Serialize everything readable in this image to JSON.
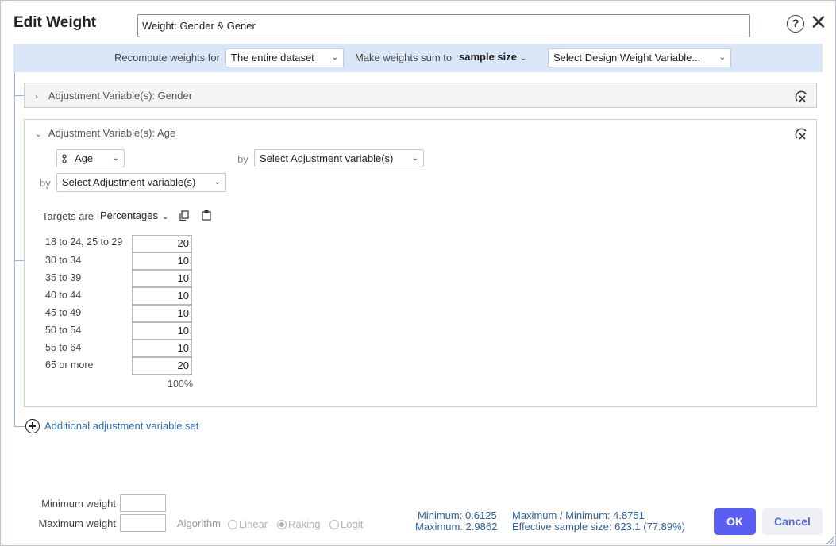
{
  "dialog": {
    "title": "Edit Weight",
    "name_value": "Weight: Gender & Gener"
  },
  "toolbar": {
    "recompute_label": "Recompute weights for",
    "recompute_value": "The entire dataset",
    "sum_label": "Make weights sum to",
    "sum_value": "sample size",
    "design_weight_placeholder": "Select Design Weight Variable..."
  },
  "panels": [
    {
      "title": "Adjustment Variable(s): Gender",
      "expanded": false
    },
    {
      "title": "Adjustment Variable(s): Age",
      "expanded": true,
      "variable": "Age",
      "by_label": "by",
      "select_adjustment": "Select Adjustment variable(s)",
      "targets_label": "Targets are",
      "targets_mode": "Percentages",
      "rows": [
        {
          "label": "18 to 24, 25 to 29",
          "value": "20"
        },
        {
          "label": "30 to 34",
          "value": "10"
        },
        {
          "label": "35 to 39",
          "value": "10"
        },
        {
          "label": "40 to 44",
          "value": "10"
        },
        {
          "label": "45 to 49",
          "value": "10"
        },
        {
          "label": "50 to 54",
          "value": "10"
        },
        {
          "label": "55 to 64",
          "value": "10"
        },
        {
          "label": "65 or more",
          "value": "20"
        }
      ],
      "total": "100%"
    }
  ],
  "add_set_label": "Additional adjustment variable set",
  "footer": {
    "min_weight_label": "Minimum weight",
    "max_weight_label": "Maximum weight",
    "algorithm_label": "Algorithm",
    "algorithms": [
      {
        "label": "Linear",
        "selected": false
      },
      {
        "label": "Raking",
        "selected": true
      },
      {
        "label": "Logit",
        "selected": false
      }
    ],
    "stats": {
      "minimum": "Minimum: 0.6125",
      "maximum": "Maximum: 2.9862",
      "max_min": "Maximum / Minimum: 4.8751",
      "effective": "Effective sample size: 623.1 (77.89%)"
    },
    "ok_label": "OK",
    "cancel_label": "Cancel"
  },
  "colors": {
    "accent": "#5a5ef2",
    "toolbar_bg": "#d9e6f7",
    "link": "#2f6db5"
  },
  "icons": [
    "help-icon",
    "close-icon",
    "remove-set-icon",
    "copy-icon",
    "paste-icon",
    "add-circle-icon",
    "ordinal-variable-icon"
  ]
}
